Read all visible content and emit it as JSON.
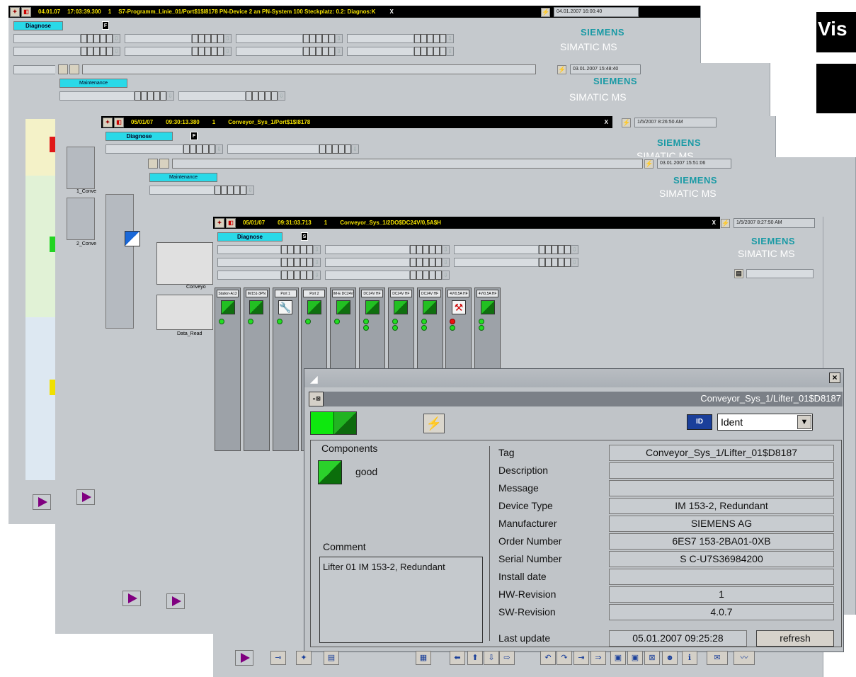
{
  "windows": {
    "w1": {
      "date": "04.01.07",
      "time": "17:03:39.300",
      "count": "1",
      "message": "S7-Programm_Linie_01/Port$1$I8178  PN-Device 2 an PN-System 100 Steckplatz: 0.2: Diagnos:K",
      "close": "X",
      "timestamp": "04.01.2007 16:00:40",
      "tab": "Diagnose",
      "flag": "F"
    },
    "w2": {
      "timestamp": "03.01.2007 15:48:40",
      "tab": "Maintenance"
    },
    "w3": {
      "date": "05/01/07",
      "time": "09:30:13.380",
      "count": "1",
      "message": "Conveyor_Sys_1/Port$1$I8178",
      "close": "X",
      "timestamp": "1/5/2007 8:26:50 AM",
      "tab": "Diagnose",
      "flag": "F"
    },
    "w4": {
      "timestamp": "03.01.2007 15:51:06",
      "tab": "Maintenance"
    },
    "w5": {
      "date": "05/01/07",
      "time": "09:31:03.713",
      "count": "1",
      "message": "Conveyor_Sys_1/2DO$DC24V/0,5A$H",
      "close": "X",
      "timestamp": "1/5/2007 8:27:50 AM",
      "tab": "Diagnose",
      "flag": "S"
    }
  },
  "brand": {
    "siemens": "SIEMENS",
    "simatic": "SIMATIC MS"
  },
  "background_labels": {
    "conveyor_1": "1_Conve",
    "conveyor_2": "2_Conve",
    "conveyo": "Conveyo",
    "data_read": "Data_Read",
    "vis": "Vis"
  },
  "modules": [
    {
      "label": "Station-A13",
      "icon": "good",
      "dots": [
        "green"
      ]
    },
    {
      "label": "IM151-3PN",
      "icon": "good",
      "dots": [
        "green"
      ]
    },
    {
      "label": "Port 1",
      "icon": "wrench",
      "dots": [
        "green"
      ]
    },
    {
      "label": "Port 2",
      "icon": "good",
      "dots": [
        "green"
      ]
    },
    {
      "label": "IM-E DC24V",
      "icon": "good",
      "dots": [
        "green"
      ]
    },
    {
      "label": "DC24V HF",
      "icon": "good",
      "dots": [
        "green",
        "green"
      ]
    },
    {
      "label": "DC24V HF",
      "icon": "good",
      "dots": [
        "green",
        "green"
      ]
    },
    {
      "label": "DC24V HF",
      "icon": "good",
      "dots": [
        "green",
        "green"
      ]
    },
    {
      "label": "4V/0,5A HF",
      "icon": "tool",
      "dots": [
        "red",
        "green"
      ]
    },
    {
      "label": "4V/0,5A HF",
      "icon": "good",
      "dots": [
        "green",
        "green"
      ]
    }
  ],
  "faceplate": {
    "close": "×",
    "pin": "-⊠",
    "tag_title": "Conveyor_Sys_1/Lifter_01$D8187",
    "view_select": "Ident",
    "view_icon": "ID",
    "components_label": "Components",
    "component_status": "good",
    "comment_label": "Comment",
    "comment_value": "Lifter 01   IM 153-2, Redundant",
    "properties": [
      {
        "key": "Tag",
        "value": "Conveyor_Sys_1/Lifter_01$D8187"
      },
      {
        "key": "Description",
        "value": ""
      },
      {
        "key": "Message",
        "value": ""
      },
      {
        "key": "Device Type",
        "value": "IM 153-2, Redundant"
      },
      {
        "key": "Manufacturer",
        "value": "SIEMENS AG"
      },
      {
        "key": "Order Number",
        "value": "6ES7 153-2BA01-0XB"
      },
      {
        "key": "Serial Number",
        "value": "S C-U7S36984200"
      },
      {
        "key": "Install date",
        "value": ""
      },
      {
        "key": "HW-Revision",
        "value": "1"
      },
      {
        "key": "SW-Revision",
        "value": "4.0.7"
      }
    ],
    "last_update_label": "Last update",
    "last_update_value": "05.01.2007 09:25:28",
    "refresh_label": "refresh"
  },
  "toolbar_icons": [
    "play-icon",
    "pin-icon",
    "new-icon",
    "print-icon",
    "save-icon",
    "left-arrow-icon",
    "up-arrow-icon",
    "down-arrow-icon",
    "right-arrow-icon",
    "undo-icon",
    "redo-icon",
    "jump-icon",
    "forward-icon",
    "window-1-icon",
    "window-2-icon",
    "window-close-icon",
    "user-icon",
    "info-icon",
    "mail-icon",
    "curve-icon"
  ]
}
